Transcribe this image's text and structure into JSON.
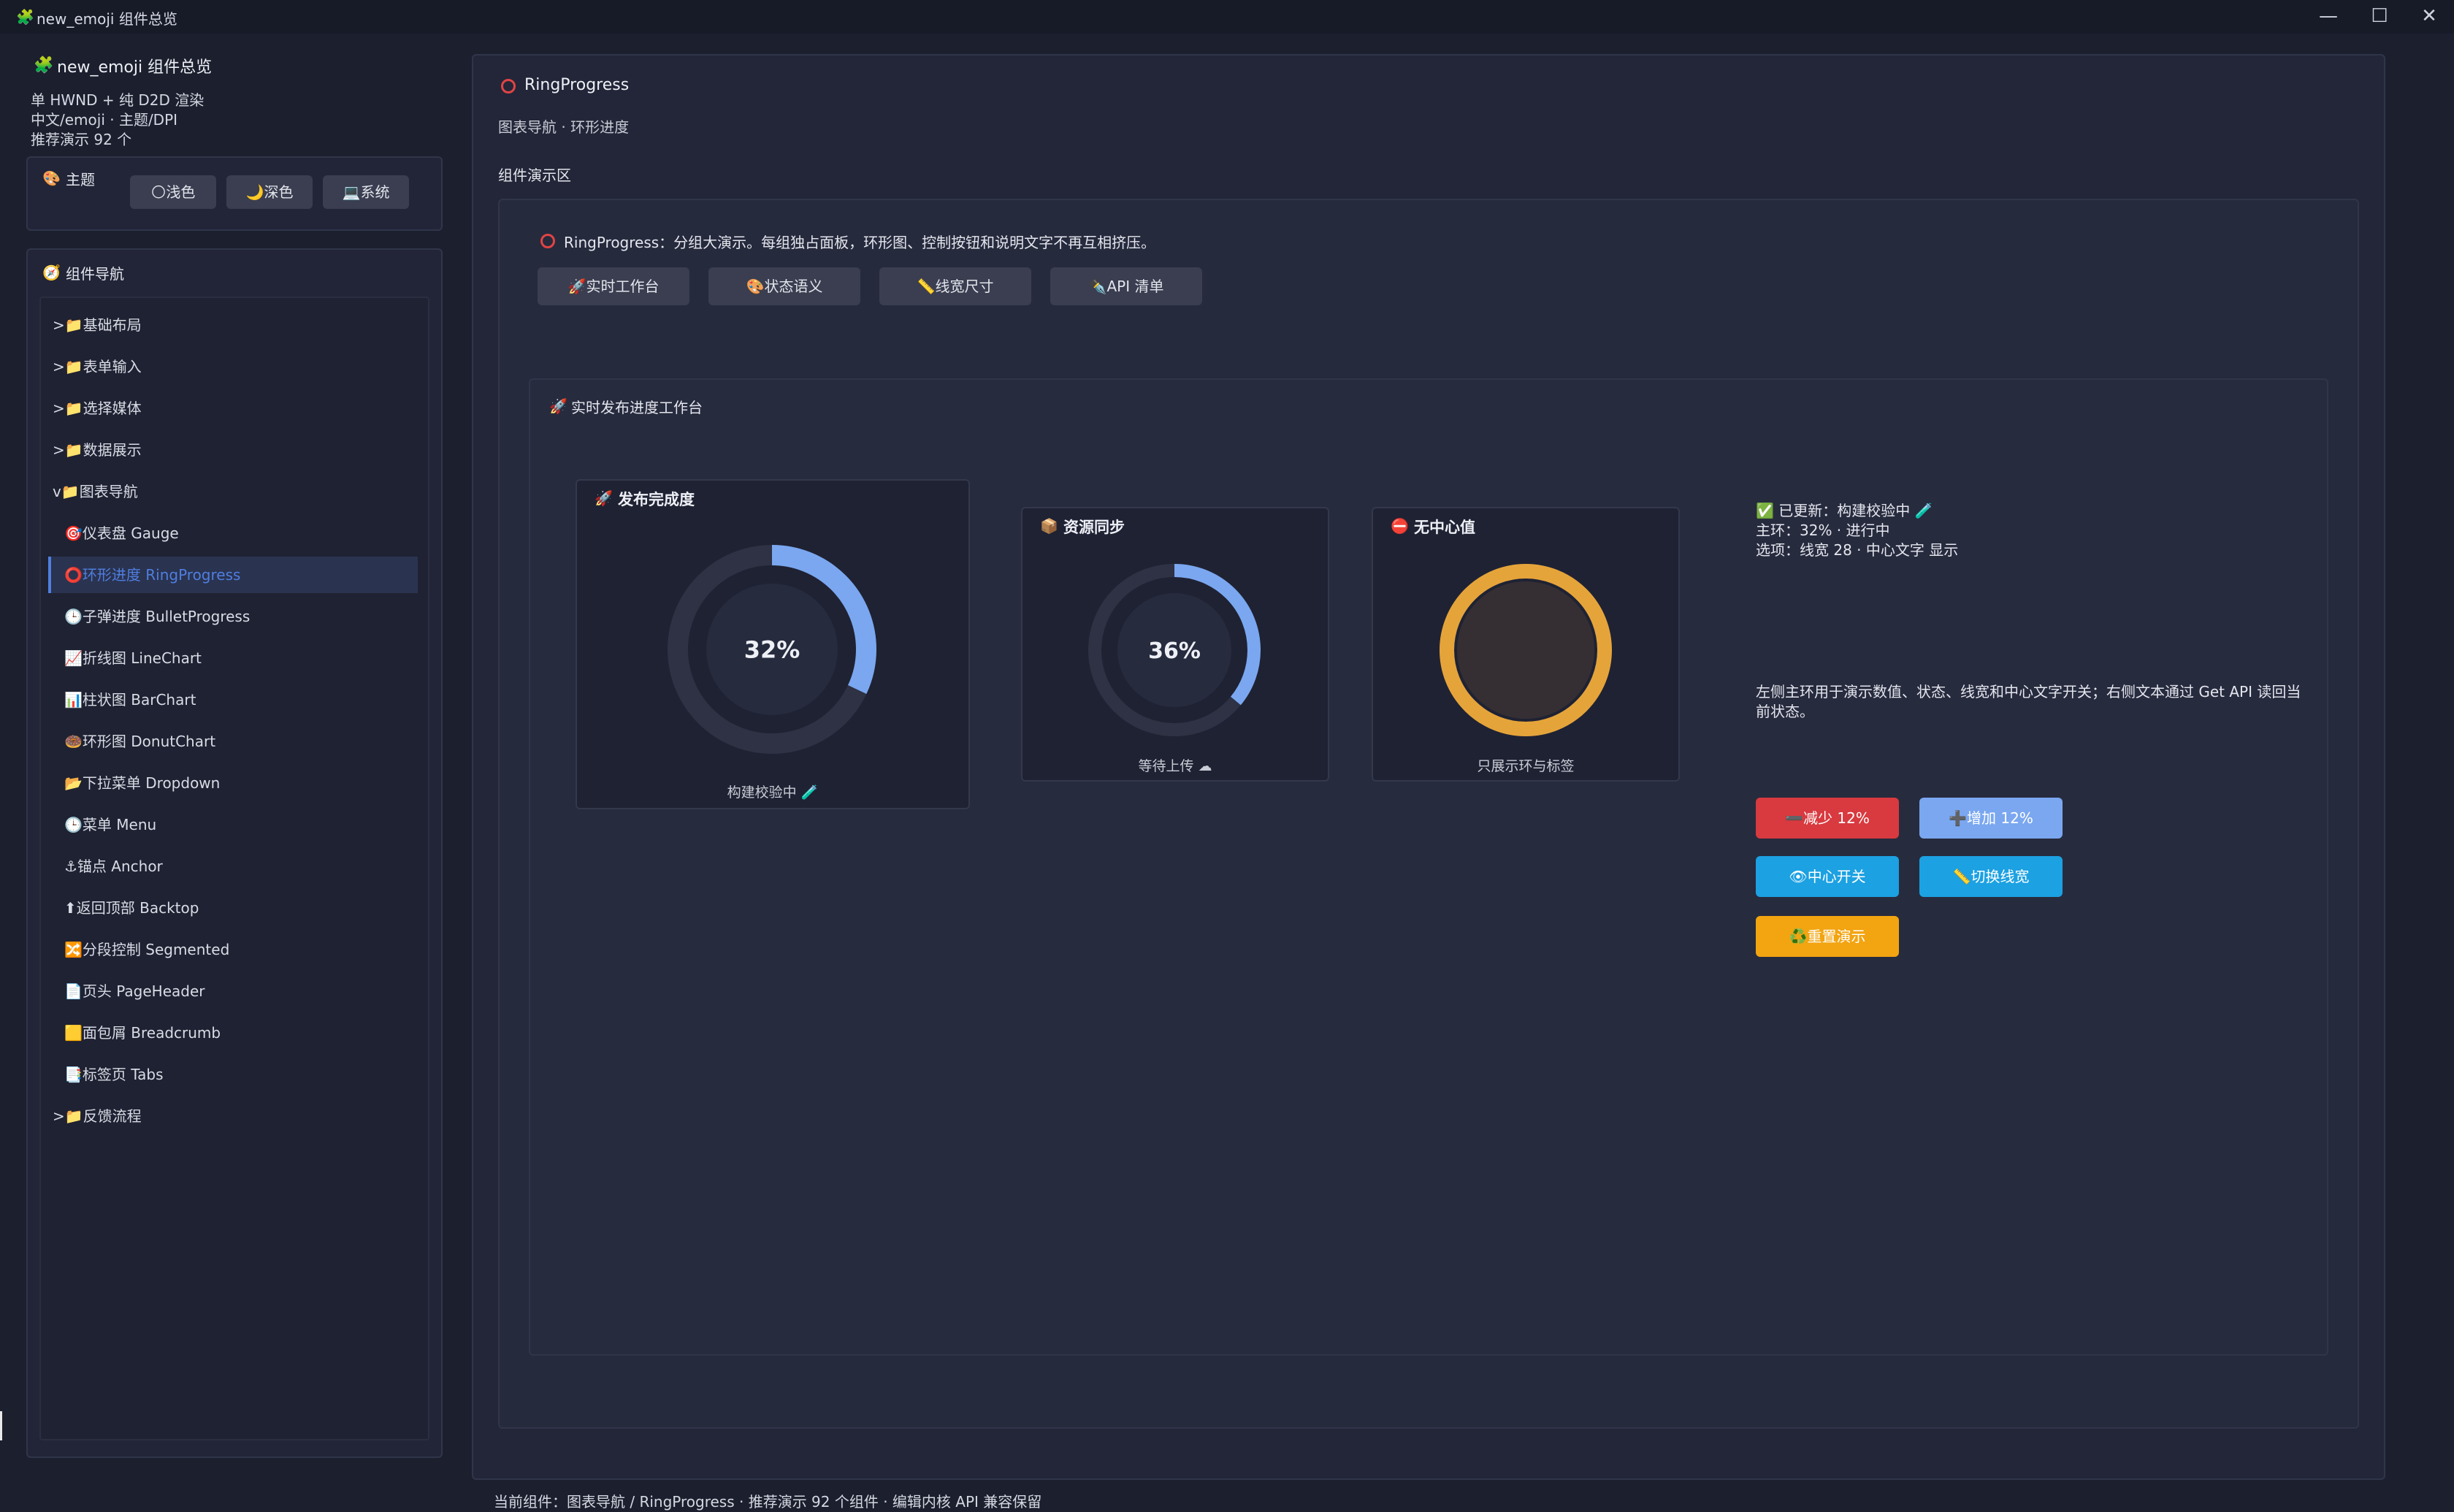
{
  "window": {
    "icon": "puzzle-icon",
    "title": "new_emoji 组件总览",
    "controls": [
      "—",
      "☐",
      "✕"
    ]
  },
  "sidebar": {
    "app_icon": "puzzle-icon",
    "app_title": "new_emoji 组件总览",
    "desc": [
      "单 HWND + 纯 D2D 渲染",
      "中文/emoji · 主题/DPI",
      "推荐演示 92 个"
    ],
    "theme": {
      "icon": "palette-icon",
      "label": "主题",
      "options": [
        {
          "icon": "sun-icon",
          "label": "浅色"
        },
        {
          "icon": "moon-icon",
          "label": "深色"
        },
        {
          "icon": "laptop-icon",
          "label": "系统"
        }
      ]
    },
    "nav": {
      "icon": "compass-icon",
      "label": "组件导航",
      "items": [
        {
          "text": ">📁基础布局",
          "level": 0
        },
        {
          "text": ">📁表单输入",
          "level": 0
        },
        {
          "text": ">📁选择媒体",
          "level": 0
        },
        {
          "text": ">📁数据展示",
          "level": 0
        },
        {
          "text": "v📁图表导航",
          "level": 0
        },
        {
          "text": "🎯仪表盘 Gauge",
          "level": 1
        },
        {
          "text": "⭕环形进度 RingProgress",
          "level": 1,
          "selected": true
        },
        {
          "text": "🕒子弹进度 BulletProgress",
          "level": 1
        },
        {
          "text": "📈折线图 LineChart",
          "level": 1
        },
        {
          "text": "📊柱状图 BarChart",
          "level": 1
        },
        {
          "text": "🍩环形图 DonutChart",
          "level": 1
        },
        {
          "text": "📂下拉菜单 Dropdown",
          "level": 1
        },
        {
          "text": "🕒菜单 Menu",
          "level": 1
        },
        {
          "text": "⚓锚点 Anchor",
          "level": 1
        },
        {
          "text": "⬆返回顶部 Backtop",
          "level": 1
        },
        {
          "text": "🔀分段控制 Segmented",
          "level": 1
        },
        {
          "text": "📄页头 PageHeader",
          "level": 1
        },
        {
          "text": "🟨面包屑 Breadcrumb",
          "level": 1
        },
        {
          "text": "📑标签页 Tabs",
          "level": 1
        },
        {
          "text": ">📁反馈流程",
          "level": 0
        }
      ]
    }
  },
  "main": {
    "icon": "ring-icon",
    "title": "RingProgress",
    "breadcrumb": "图表导航 · 环形进度",
    "demo_title": "组件演示区",
    "intro": "RingProgress：分组大演示。每组独占面板，环形图、控制按钮和说明文字不再互相挤压。",
    "chips": [
      {
        "icon": "rocket-icon",
        "label": "🚀实时工作台"
      },
      {
        "icon": "palette-icon",
        "label": "🎨状态语义"
      },
      {
        "icon": "ruler-icon",
        "label": "📏线宽尺寸"
      },
      {
        "icon": "pen-icon",
        "label": "✒️API 清单"
      }
    ],
    "workspace": {
      "icon": "rocket-icon",
      "title": "实时发布进度工作台",
      "cards": [
        {
          "icon": "rocket-icon",
          "title": "发布完成度",
          "value": 32,
          "label": "32%",
          "caption": "构建校验中 🧪",
          "color": "#7aa7f0"
        },
        {
          "icon": "box-icon",
          "title": "资源同步",
          "value": 36,
          "label": "36%",
          "caption": "等待上传 ☁",
          "color": "#7aa7f0"
        },
        {
          "icon": "stop-icon",
          "title": "无中心值",
          "value": 100,
          "label": "",
          "caption": "只展示环与标签",
          "color": "#e5a43a"
        }
      ],
      "info": [
        "✅ 已更新：构建校验中 🧪",
        "主环：32% · 进行中",
        "选项：线宽 28 · 中心文字 显示"
      ],
      "desc": "左侧主环用于演示数值、状态、线宽和中心文字开关；右侧文本通过 Get API 读回当前状态。",
      "buttons": [
        {
          "label": "➖减少 12%",
          "color": "#d83a3f"
        },
        {
          "label": "➕增加 12%",
          "color": "#7aa7f0"
        },
        {
          "label": "👁中心开关",
          "color": "#1ca1e2"
        },
        {
          "label": "📏切换线宽",
          "color": "#1ca1e2"
        },
        {
          "label": "♻️重置演示",
          "color": "#f2a411"
        }
      ]
    }
  },
  "status_bar": "当前组件：图表导航 / RingProgress · 推荐演示 92 个组件 · 编辑内核 API 兼容保留"
}
